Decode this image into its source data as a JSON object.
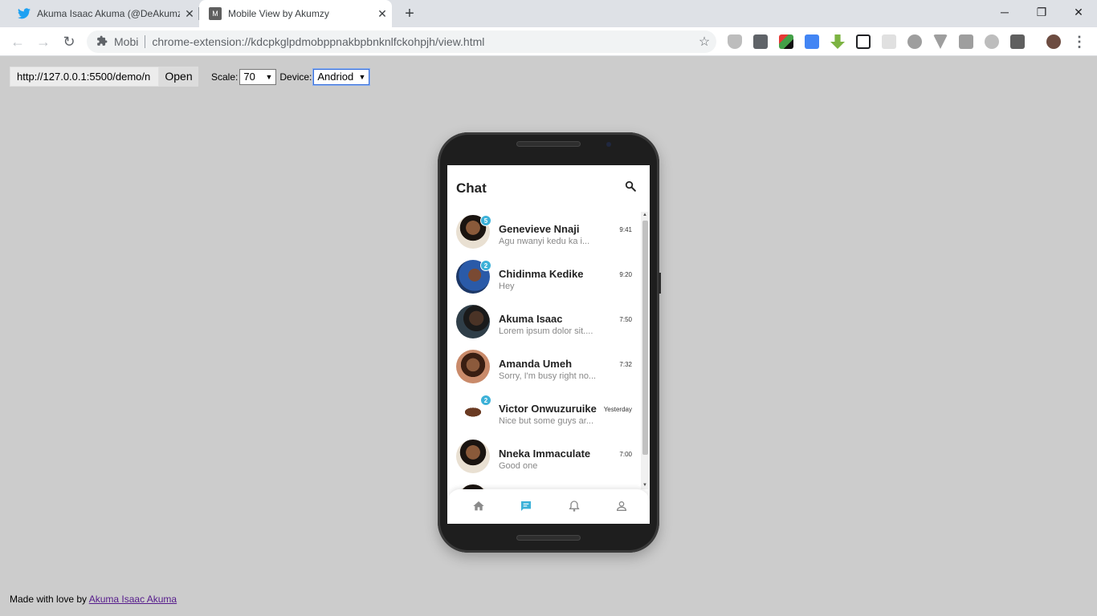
{
  "browser": {
    "tabs": [
      {
        "label": "Akuma Isaac Akuma (@DeAkumz",
        "icon": "twitter-icon"
      },
      {
        "label": "Mobile View by Akumzy",
        "icon": "m-favicon-icon",
        "favicon_letter": "M"
      }
    ],
    "address": {
      "site": "Mobi",
      "url": "chrome-extension://kdcpkglpdmobppnakbpbnknlfckohpjh/view.html"
    }
  },
  "controls": {
    "url_value": "http://127.0.0.1:5500/demo/n",
    "open_label": "Open",
    "scale_label": "Scale:",
    "scale_value": "70",
    "device_label": "Device:",
    "device_value": "Andriod"
  },
  "app": {
    "title": "Chat",
    "chats": [
      {
        "name": "Genevieve Nnaji",
        "message": "Agu nwanyi kedu ka i...",
        "time": "9:41",
        "badge": "5"
      },
      {
        "name": "Chidinma Kedike",
        "message": "Hey",
        "time": "9:20",
        "badge": "2"
      },
      {
        "name": "Akuma Isaac",
        "message": "Lorem ipsum dolor sit....",
        "time": "7:50",
        "badge": ""
      },
      {
        "name": "Amanda Umeh",
        "message": "Sorry, I'm busy right no...",
        "time": "7:32",
        "badge": ""
      },
      {
        "name": "Victor Onwuzuruike",
        "message": "Nice but some guys ar...",
        "time": "Yesterday",
        "badge": "2"
      },
      {
        "name": "Nneka Immaculate",
        "message": "Good one",
        "time": "7:00",
        "badge": ""
      }
    ],
    "nav": [
      "home-icon",
      "chat-icon",
      "bell-icon",
      "user-icon"
    ],
    "accent": "#3cb1d8"
  },
  "footer": {
    "prefix": "Made with love by ",
    "link": "Akuma Isaac Akuma"
  }
}
